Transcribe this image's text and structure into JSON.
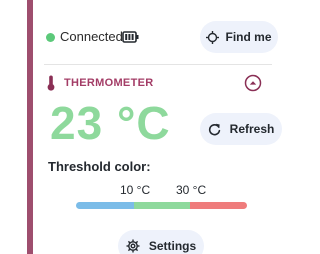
{
  "colors": {
    "accent_bar": "#9e4e6e",
    "connected_dot": "#5cc97a",
    "button_bg": "#eef2fb",
    "section_title": "#a33c66",
    "thermometer_icon": "#8a2f55",
    "temperature_value": "#8ed99c",
    "divider": "#e4e4e4",
    "gauge_low": "#7bbce8",
    "gauge_mid": "#8ed99c",
    "gauge_high": "#ef7c7c",
    "icon_dark": "#24292f"
  },
  "status": {
    "text": "Connected",
    "battery_icon": "battery-full-icon"
  },
  "find_button": {
    "label": "Find me",
    "icon": "crosshair-icon"
  },
  "section": {
    "title": "THERMOMETER",
    "icon": "thermometer-icon",
    "collapse_icon": "chevron-up-icon"
  },
  "temperature": {
    "value": "23 °C"
  },
  "refresh_button": {
    "label": "Refresh",
    "icon": "refresh-icon"
  },
  "threshold": {
    "label": "Threshold color:",
    "low_label": "10 °C",
    "high_label": "30 °C"
  },
  "settings_button": {
    "label": "Settings",
    "icon": "gear-icon"
  }
}
